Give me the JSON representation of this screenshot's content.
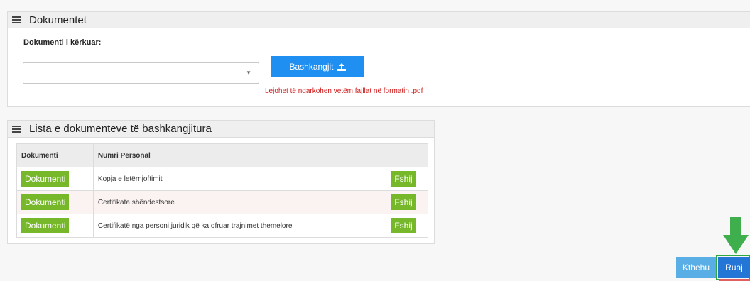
{
  "documents_panel": {
    "title": "Dokumentet",
    "required_label": "Dokumenti i kërkuar:",
    "select_value": "",
    "attach_label": "Bashkangjit",
    "hint": "Lejohet të ngarkohen vetëm fajllat në formatin .pdf"
  },
  "list_panel": {
    "title": "Lista e dokumenteve të bashkangjitura",
    "columns": [
      "Dokumenti",
      "Numri Personal",
      ""
    ],
    "rows": [
      {
        "doc_button": "Dokumenti",
        "name": "Kopja e letërnjoftimit",
        "delete": "Fshij"
      },
      {
        "doc_button": "Dokumenti",
        "name": "Certifikata shëndestsore",
        "delete": "Fshij"
      },
      {
        "doc_button": "Dokumenti",
        "name": "Certifikatë nga personi juridik që ka ofruar trajnimet themelore",
        "delete": "Fshij"
      }
    ]
  },
  "footer": {
    "back_label": "Kthehu",
    "save_label": "Ruaj"
  },
  "colors": {
    "primary_blue": "#1f8ff2",
    "green_button": "#76b82a",
    "hint_red": "#d01a1a",
    "arrow_green": "#3fae4c"
  },
  "icons": [
    "hamburger-icon",
    "upload-icon",
    "chevron-down-icon",
    "arrow-down-icon"
  ]
}
